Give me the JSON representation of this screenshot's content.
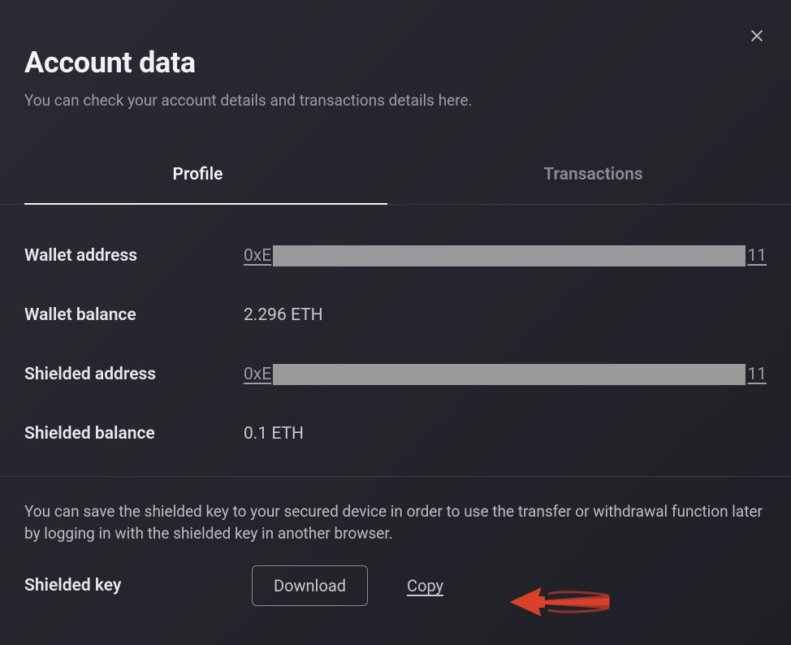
{
  "header": {
    "title": "Account data",
    "subtitle": "You can check your account details and transactions details here."
  },
  "tabs": {
    "profile": "Profile",
    "transactions": "Transactions"
  },
  "profile": {
    "wallet_address_label": "Wallet address",
    "wallet_address_prefix": "0xE",
    "wallet_address_suffix": "11",
    "wallet_balance_label": "Wallet balance",
    "wallet_balance_value": "2.296 ETH",
    "shielded_address_label": "Shielded address",
    "shielded_address_prefix": "0xE",
    "shielded_address_suffix": "11",
    "shielded_balance_label": "Shielded balance",
    "shielded_balance_value": "0.1 ETH"
  },
  "footer": {
    "info_text": "You can save the shielded key to your secured device in order to use the transfer or withdrawal function later by logging in with the shielded key in another browser.",
    "shielded_key_label": "Shielded key",
    "download_label": "Download",
    "copy_label": "Copy"
  },
  "colors": {
    "annotation_arrow": "#d8402a"
  }
}
